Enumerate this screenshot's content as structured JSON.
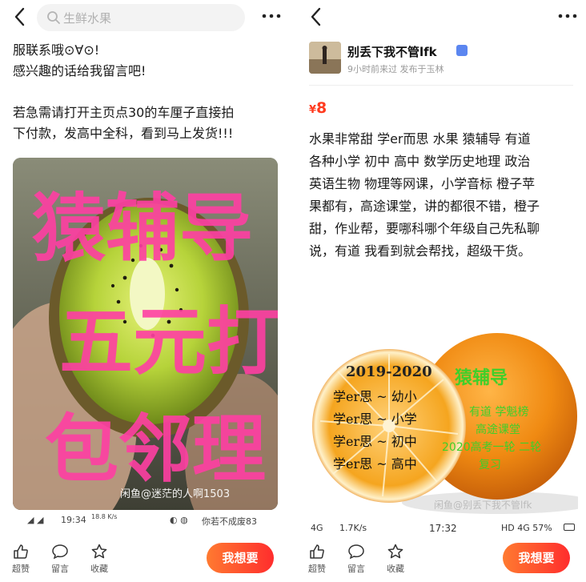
{
  "left": {
    "search": {
      "placeholder": "生鲜水果"
    },
    "description": {
      "lines": [
        "服联系哦⊙∀⊙!",
        "感兴趣的话给我留言吧!",
        "",
        "若急需请打开主页点30的车厘子直接拍",
        "下付款，发高中全科，看到马上发货!!!"
      ]
    },
    "image": {
      "overlay_lines": [
        "猿辅导",
        "五元打",
        "包邻理"
      ],
      "watermark": "闲鱼@迷茫的人啊1503"
    },
    "status": {
      "time": "19:34",
      "speed": "18.8 K/s",
      "right": "你若不成废83"
    },
    "actions": {
      "like": "超赞",
      "comment": "留言",
      "favorite": "收藏",
      "want": "我想要"
    }
  },
  "right": {
    "seller": {
      "name": "别丢下我不管lfk",
      "meta": "9小时前来过 发布于玉林"
    },
    "price": {
      "currency": "¥",
      "value": "8"
    },
    "description": {
      "lines": [
        "水果非常甜 学er而思 水果  猿辅导  有道",
        "各种小学 初中 高中 数学历史地理 政治",
        "英语生物 物理等网课，小学音标 橙子苹",
        "果都有，高途课堂，讲的都很不错，橙子",
        "甜，作业帮，要哪科哪个年级自己先私聊",
        "说，有道 我看到就会帮找，超级干货。"
      ]
    },
    "image": {
      "year": "2019-2020",
      "grades": [
        "学er思 ~ 幼小",
        "学er思 ~ 小学",
        "学er思 ~ 初中",
        "学er思 ~ 高中"
      ],
      "brand": "猿辅导",
      "lines_green": [
        "有道  学魁榜",
        "高途课堂",
        "2020高考一轮 二轮",
        "复习"
      ],
      "watermark": "闲鱼@别丢下我不管lfk"
    },
    "status": {
      "signal": "4G",
      "speed": "1.7K/s",
      "time": "17:32",
      "battery": "HD 4G 57%"
    },
    "actions": {
      "like": "超赞",
      "comment": "留言",
      "favorite": "收藏",
      "want": "我想要"
    }
  },
  "colors": {
    "want_button_start": "#ff7a30",
    "want_button_end": "#ff2d2d",
    "price": "#ff3b1f",
    "overlay_pink": "#ff3fa3",
    "orange_green_text": "#3fcf2a"
  }
}
